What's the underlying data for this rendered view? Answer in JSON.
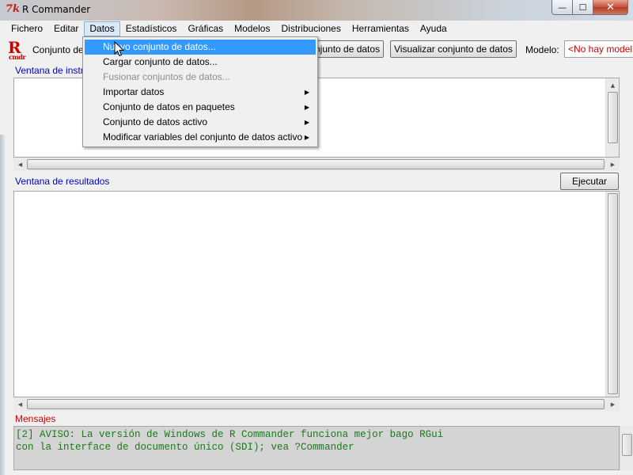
{
  "window": {
    "title": "R Commander",
    "minimize_label": "—",
    "maximize_label": "☐",
    "close_label": "✕"
  },
  "menubar": {
    "items": [
      {
        "label": "Fichero"
      },
      {
        "label": "Editar"
      },
      {
        "label": "Datos"
      },
      {
        "label": "Estadísticos"
      },
      {
        "label": "Gráficas"
      },
      {
        "label": "Modelos"
      },
      {
        "label": "Distribuciones"
      },
      {
        "label": "Herramientas"
      },
      {
        "label": "Ayuda"
      }
    ]
  },
  "toolbar": {
    "logo_big": "R",
    "logo_small": "cmdr",
    "dataset_label": "Conjunto de",
    "edit_dataset_button": "njunto de datos",
    "view_dataset_button": "Visualizar conjunto de datos",
    "model_label": "Modelo:",
    "model_value": "<No hay model"
  },
  "script_window": {
    "label": "Ventana de instr"
  },
  "output_window": {
    "label": "Ventana de resultados",
    "execute_button": "Ejecutar"
  },
  "messages_window": {
    "label": "Mensajes",
    "lines": [
      "[2] AVISO: La versión de Windows de R Commander funciona mejor bago RGui",
      "con la interface de documento único (SDI); vea ?Commander"
    ]
  },
  "datos_menu": {
    "items": [
      {
        "label": "Nuevo conjunto de datos...",
        "state": "highlighted"
      },
      {
        "label": "Cargar conjunto de datos..."
      },
      {
        "label": "Fusionar conjuntos de datos...",
        "state": "disabled"
      },
      {
        "label": "Importar datos",
        "submenu": true
      },
      {
        "label": "Conjunto de datos en paquetes",
        "submenu": true
      },
      {
        "label": "Conjunto de datos activo",
        "submenu": true
      },
      {
        "label": "Modificar variables del conjunto de datos activo",
        "submenu": true
      }
    ]
  },
  "colors": {
    "highlight": "#3399ff",
    "label_blue": "#0000c8",
    "label_red": "#d00000",
    "message_green": "#1a7a1a"
  }
}
